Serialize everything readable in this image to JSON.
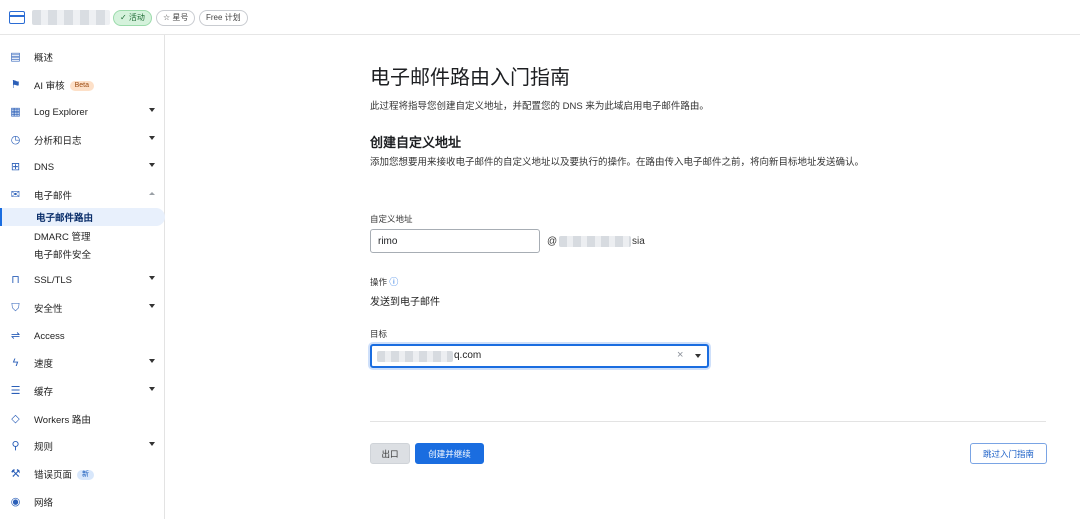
{
  "topbar": {
    "status_badge": "✓ 活动",
    "star_label": "☆ 星号",
    "plan_label": "Free 计划"
  },
  "sidebar": {
    "items": [
      {
        "label": "概述",
        "icon": "document-icon",
        "glyph": "▤"
      },
      {
        "label": "AI 审核",
        "icon": "ai-audit-icon",
        "glyph": "⚑",
        "badge": "Beta"
      },
      {
        "label": "Log Explorer",
        "icon": "log-icon",
        "glyph": "▦",
        "expandable": true
      },
      {
        "label": "分析和日志",
        "icon": "clock-icon",
        "glyph": "◷",
        "expandable": true
      },
      {
        "label": "DNS",
        "icon": "network-icon",
        "glyph": "⊞",
        "expandable": true
      },
      {
        "label": "电子邮件",
        "icon": "mail-icon",
        "glyph": "✉",
        "expanded": true
      },
      {
        "label": "SSL/TLS",
        "icon": "lock-icon",
        "glyph": "🔒",
        "expandable": true
      },
      {
        "label": "安全性",
        "icon": "shield-icon",
        "glyph": "⛉",
        "expandable": true
      },
      {
        "label": "Access",
        "icon": "access-icon",
        "glyph": "⇌"
      },
      {
        "label": "速度",
        "icon": "bolt-icon",
        "glyph": "ϟ",
        "expandable": true
      },
      {
        "label": "缓存",
        "icon": "storage-icon",
        "glyph": "☰",
        "expandable": true
      },
      {
        "label": "Workers 路由",
        "icon": "code-icon",
        "glyph": "◇"
      },
      {
        "label": "规则",
        "icon": "rules-icon",
        "glyph": "⚲",
        "expandable": true
      },
      {
        "label": "错误页面",
        "icon": "wrench-icon",
        "glyph": "⚒",
        "badge": "新"
      },
      {
        "label": "网络",
        "icon": "location-icon",
        "glyph": "◉"
      }
    ],
    "email_sub": [
      {
        "label": "电子邮件路由",
        "active": true
      },
      {
        "label": "DMARC 管理"
      },
      {
        "label": "电子邮件安全"
      }
    ]
  },
  "main": {
    "title": "电子邮件路由入门指南",
    "intro": "此过程将指导您创建自定义地址，并配置您的 DNS 来为此域启用电子邮件路由。",
    "section_title": "创建自定义地址",
    "section_desc": "添加您想要用来接收电子邮件的自定义地址以及要执行的操作。在路由传入电子邮件之前，将向新目标地址发送确认。",
    "custom_address_label": "自定义地址",
    "custom_address_value": "rimo",
    "at_sign": "@",
    "domain_suffix": "sia",
    "action_label": "操作",
    "action_value": "发送到电子邮件",
    "target_label": "目标",
    "target_value_suffix": "q.com",
    "exit_button": "出口",
    "create_button": "创建并继续",
    "skip_button": "跳过入门指南"
  },
  "colors": {
    "accent": "#1a6de0",
    "active_badge_bg": "#d5f2dc",
    "beta_badge_bg": "#fde0c8",
    "new_badge_bg": "#d8e7fb"
  }
}
